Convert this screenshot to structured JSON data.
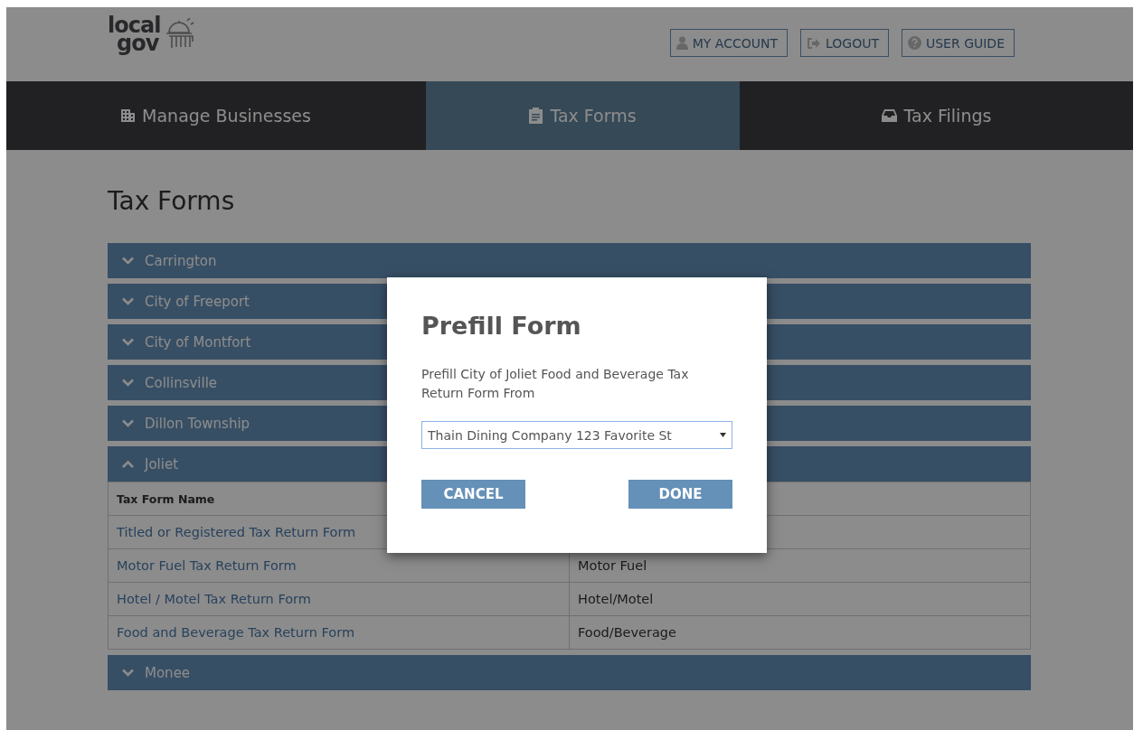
{
  "logo": {
    "line1": "local",
    "line2": "gov"
  },
  "header_buttons": [
    {
      "label": "MY ACCOUNT",
      "kind": "account"
    },
    {
      "label": "LOGOUT",
      "kind": "logout"
    },
    {
      "label": "USER GUIDE",
      "kind": "guide"
    }
  ],
  "nav_tabs": [
    {
      "label": "Manage Businesses",
      "kind": "building",
      "selected": false
    },
    {
      "label": "Tax Forms",
      "kind": "clipboard",
      "selected": true
    },
    {
      "label": "Tax Filings",
      "kind": "inbox",
      "selected": false
    }
  ],
  "page_title": "Tax Forms",
  "jurisdictions": [
    {
      "name": "Carrington",
      "expanded": false
    },
    {
      "name": "City of Freeport",
      "expanded": false
    },
    {
      "name": "City of Montfort",
      "expanded": false
    },
    {
      "name": "Collinsville",
      "expanded": false
    },
    {
      "name": "Dillon Township",
      "expanded": false
    },
    {
      "name": "Joliet",
      "expanded": true,
      "table": {
        "columns": [
          "Tax Form Name"
        ],
        "rows": [
          {
            "form": "Titled or Registered Tax Return Form"
          },
          {
            "form": "Motor Fuel Tax Return Form",
            "type": "Motor Fuel"
          },
          {
            "form": "Hotel / Motel Tax Return Form",
            "type": "Hotel/Motel"
          },
          {
            "form": "Food and Beverage Tax Return Form",
            "type": "Food/Beverage"
          }
        ]
      }
    },
    {
      "name": "Monee",
      "expanded": false
    }
  ],
  "modal": {
    "title": "Prefill Form",
    "message": "Prefill City of Joliet Food and Beverage Tax Return Form From",
    "select_value": "Thain Dining Company 123 Favorite St",
    "buttons": [
      "CANCEL",
      "DONE"
    ]
  }
}
